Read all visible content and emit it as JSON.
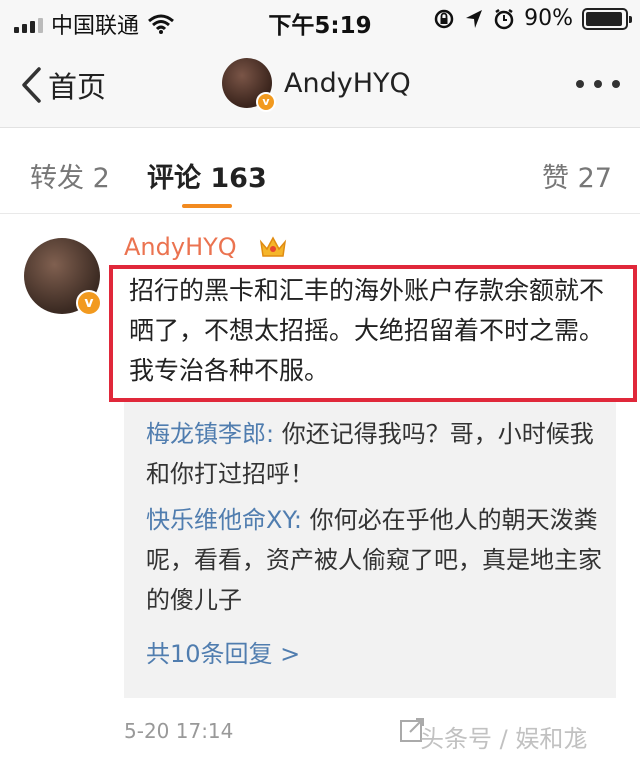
{
  "status_bar": {
    "carrier": "中国联通",
    "time": "下午5:19",
    "battery": "90%"
  },
  "nav": {
    "back_label": "首页",
    "title": "AndyHYQ"
  },
  "tabs": {
    "repost": "转发 2",
    "comment": "评论 163",
    "like": "赞 27"
  },
  "comment": {
    "username": "AndyHYQ",
    "text": "招行的黑卡和汇丰的海外账户存款余额就不晒了，不想太招摇。大绝招留着不时之需。我专治各种不服。",
    "replies": [
      {
        "name": "梅龙镇李郎:",
        "text": " 你还记得我吗？哥，小时候我和你打过招呼！"
      },
      {
        "name": "快乐维他命XY:",
        "text": " 你何必在乎他人的朝天泼粪呢，看看，资产被人偷窥了吧，真是地主家的傻儿子"
      }
    ],
    "more_replies": "共10条回复 >",
    "date": "5-20 17:14"
  },
  "watermark": "头条号 / 娱和尨",
  "colors": {
    "accent": "#f28a1f",
    "username": "#eb7350",
    "link": "#507daf",
    "highlight_box": "#e0283a"
  }
}
